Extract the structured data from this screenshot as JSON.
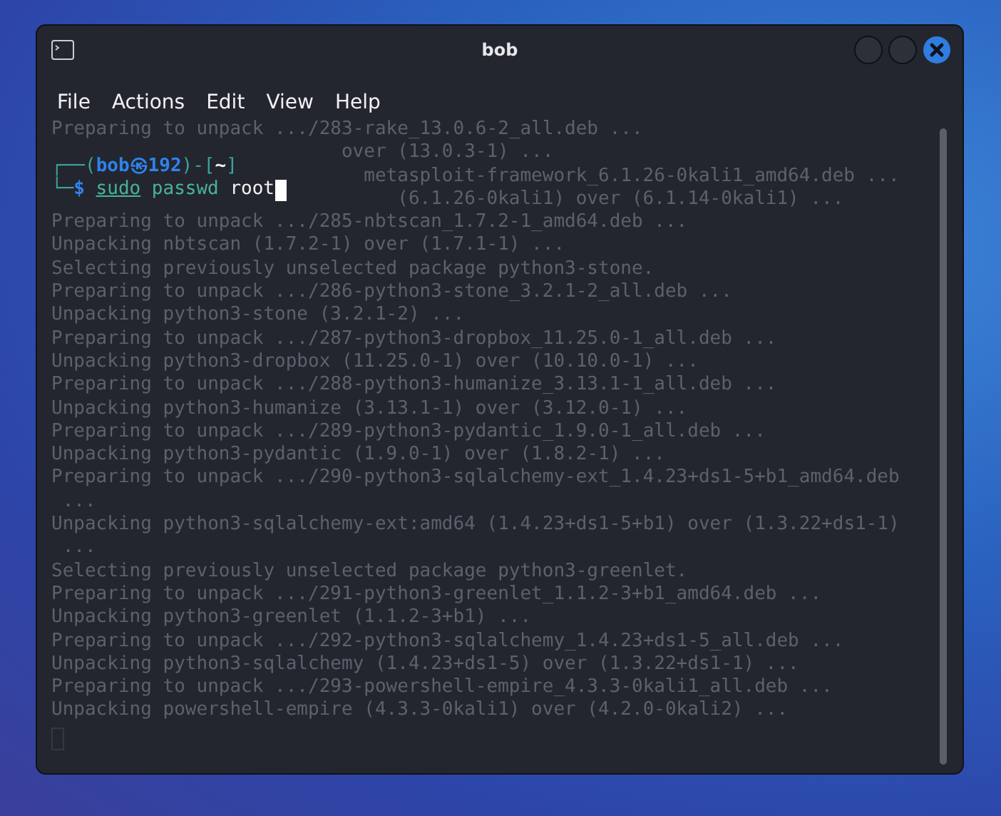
{
  "window": {
    "title": "bob"
  },
  "menu": [
    "File",
    "Actions",
    "Edit",
    "View",
    "Help"
  ],
  "prompt": [
    {
      "kind": "frame",
      "text": "┌──("
    },
    {
      "kind": "user",
      "text": "bob㉿192"
    },
    {
      "kind": "frame",
      "text": ")-["
    },
    {
      "kind": "path",
      "text": "~"
    },
    {
      "kind": "frame",
      "text": "]"
    }
  ],
  "command_line": [
    {
      "kind": "frame",
      "text": "└─"
    },
    {
      "kind": "symbol",
      "text": "$"
    },
    {
      "kind": "sudo",
      "text": "sudo"
    },
    {
      "kind": "command",
      "text": "passwd"
    },
    {
      "kind": "arg",
      "text": "root"
    }
  ],
  "background_window": {
    "lines": [
      "Preparing to unpack .../283-rake_13.0.6-2_all.deb ...",
      "over (13.0.3-1) ...",
      "metasploit-framework_6.1.26-0kali1_amd64.deb ...",
      "(6.1.26-0kali1) over (6.1.14-0kali1) ...",
      "Preparing to unpack .../285-nbtscan_1.7.2-1_amd64.deb ...",
      "Unpacking nbtscan (1.7.2-1) over (1.7.1-1) ...",
      "Selecting previously unselected package python3-stone.",
      "Preparing to unpack .../286-python3-stone_3.2.1-2_all.deb ...",
      "Unpacking python3-stone (3.2.1-2) ...",
      "Preparing to unpack .../287-python3-dropbox_11.25.0-1_all.deb ...",
      "Unpacking python3-dropbox (11.25.0-1) over (10.10.0-1) ...",
      "Preparing to unpack .../288-python3-humanize_3.13.1-1_all.deb ...",
      "Unpacking python3-humanize (3.13.1-1) over (3.12.0-1) ...",
      "Preparing to unpack .../289-python3-pydantic_1.9.0-1_all.deb ...",
      "Unpacking python3-pydantic (1.9.0-1) over (1.8.2-1) ...",
      "Preparing to unpack .../290-python3-sqlalchemy-ext_1.4.23+ds1-5+b1_amd64.deb",
      " ...",
      "Unpacking python3-sqlalchemy-ext:amd64 (1.4.23+ds1-5+b1) over (1.3.22+ds1-1)",
      " ...",
      "Selecting previously unselected package python3-greenlet.",
      "Preparing to unpack .../291-python3-greenlet_1.1.2-3+b1_amd64.deb ...",
      "Unpacking python3-greenlet (1.1.2-3+b1) ...",
      "Preparing to unpack .../292-python3-sqlalchemy_1.4.23+ds1-5_all.deb ...",
      "Unpacking python3-sqlalchemy (1.4.23+ds1-5) over (1.3.22+ds1-1) ...",
      "Preparing to unpack .../293-powershell-empire_4.3.3-0kali1_all.deb ...",
      "Unpacking powershell-empire (4.3.3-0kali1) over (4.2.0-0kali2) ..."
    ]
  }
}
